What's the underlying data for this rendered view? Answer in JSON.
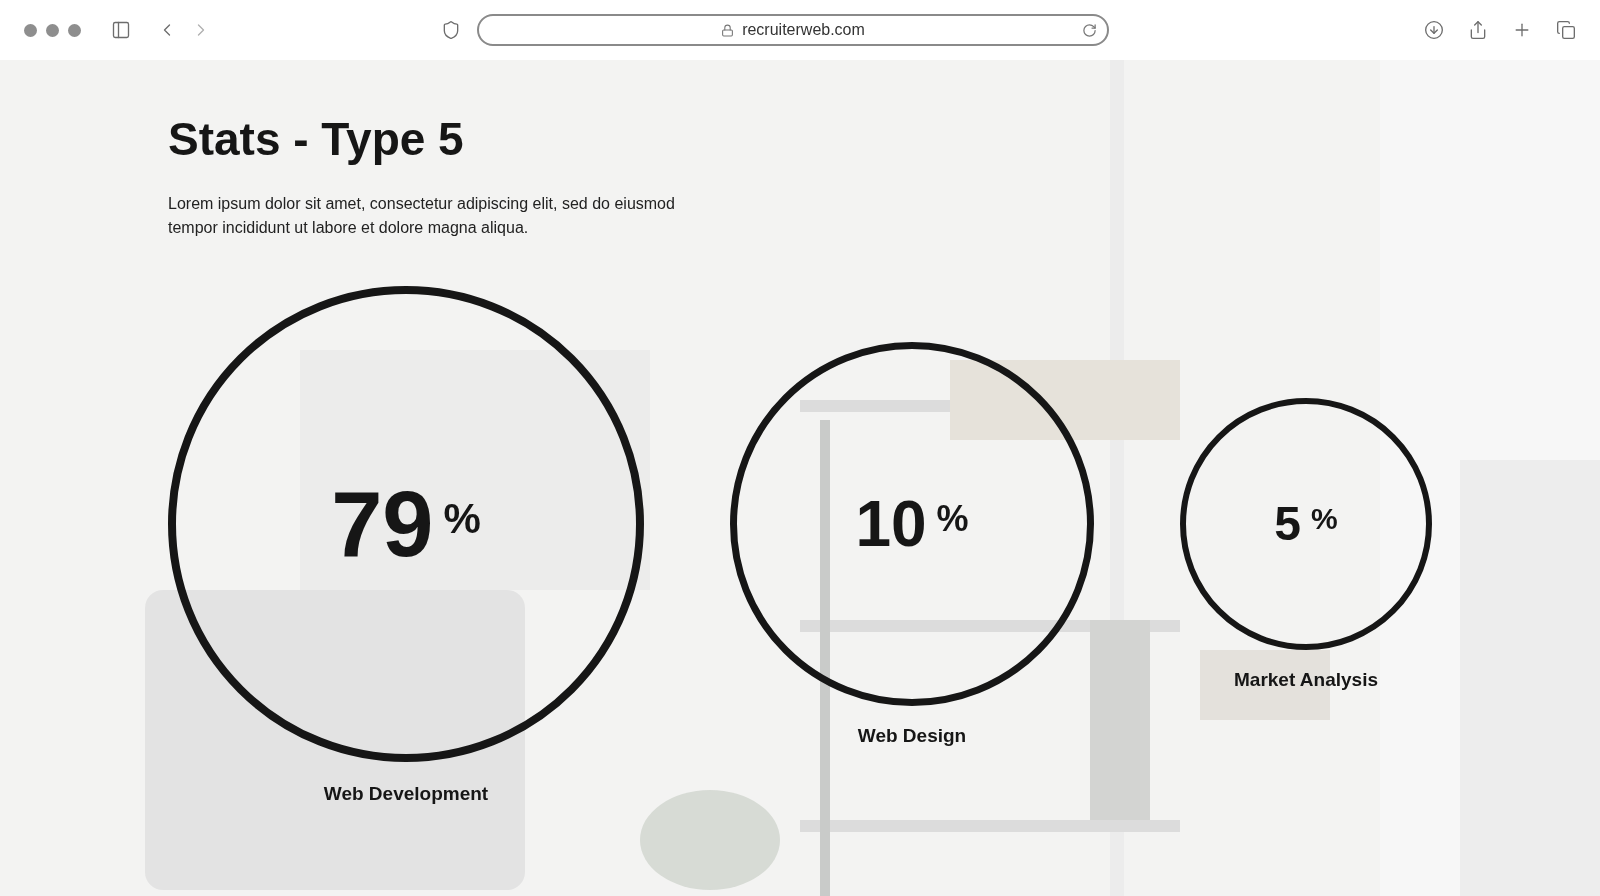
{
  "browser": {
    "url": "recruiterweb.com"
  },
  "page": {
    "title": "Stats - Type 5",
    "description": "Lorem ipsum dolor sit amet, consectetur adipiscing elit, sed do eiusmod tempor incididunt ut labore et dolore magna aliqua."
  },
  "stats": [
    {
      "value": "79",
      "unit": "%",
      "label": "Web Development",
      "kind": "large"
    },
    {
      "value": "10",
      "unit": "%",
      "label": "Web Design",
      "kind": "medium"
    },
    {
      "value": "5",
      "unit": "%",
      "label": "Market Analysis",
      "kind": "small"
    }
  ]
}
